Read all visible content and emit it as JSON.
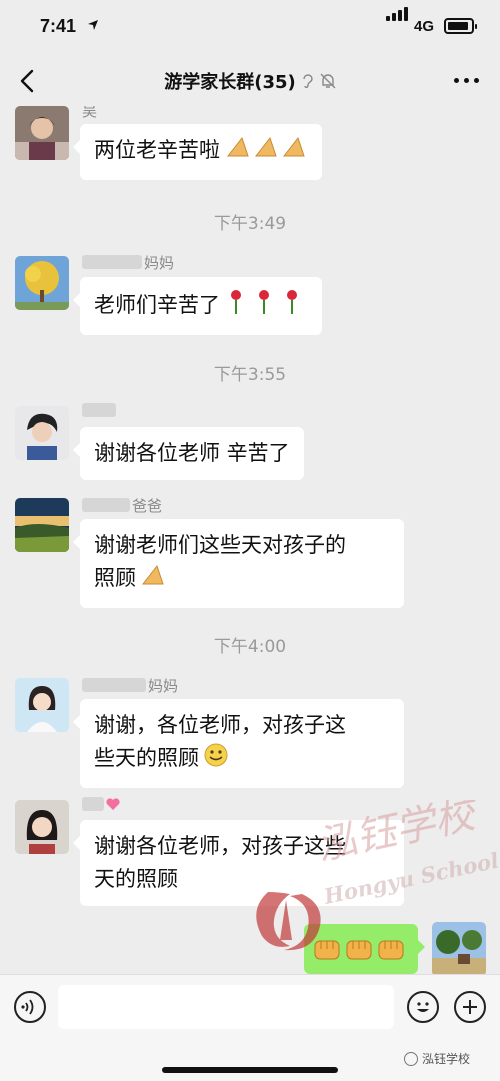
{
  "status": {
    "time": "7:41",
    "network": "4G"
  },
  "nav": {
    "title": "游学家长群(35)"
  },
  "messages": [
    {
      "sender": "吴",
      "text": "两位老辛苦啦",
      "emoji": "praying-hands"
    },
    {
      "timestamp": "下午3:49"
    },
    {
      "sender": "妈妈",
      "text": "老师们辛苦了",
      "emoji": "rose"
    },
    {
      "timestamp": "下午3:55"
    },
    {
      "sender": "",
      "text": "谢谢各位老师 辛苦了"
    },
    {
      "sender": "爸爸",
      "text_line1": "谢谢老师们这些天对孩子的",
      "text_line2": "照顾",
      "emoji": "praying-hands"
    },
    {
      "timestamp": "下午4:00"
    },
    {
      "sender": "妈妈",
      "text_line1": "谢谢，各位老师，对孩子这",
      "text_line2": "些天的照顾",
      "emoji": "smiley"
    },
    {
      "sender": "",
      "text_line1": "谢谢各位老师，对孩子这些",
      "text_line2": "天的照顾"
    },
    {
      "mine": true,
      "emoji": "fist"
    }
  ],
  "watermark": {
    "cn": "泓钰学校",
    "en": "Hongyu School"
  },
  "source": {
    "label": "泓钰学校"
  },
  "colors": {
    "background": "#ededed",
    "bubble_in": "#ffffff",
    "bubble_out": "#95ec69",
    "timestamp": "#9a9a9a"
  }
}
